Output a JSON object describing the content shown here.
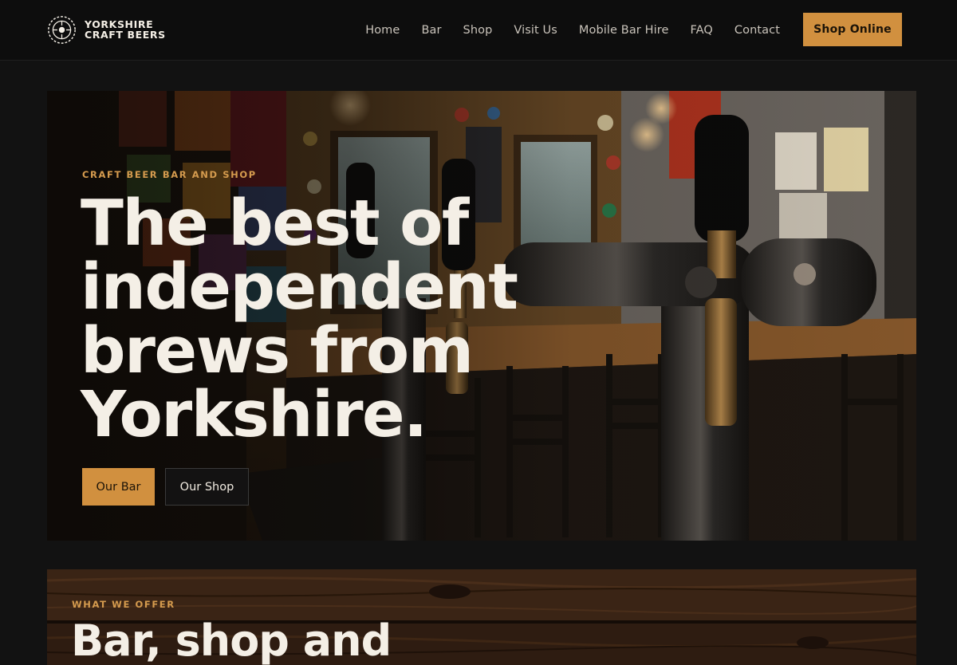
{
  "brand": {
    "line1": "YORKSHIRE",
    "line2": "CRAFT BEERS",
    "logo_icon": "roundel-logo-icon"
  },
  "nav": {
    "items": [
      {
        "label": "Home"
      },
      {
        "label": "Bar"
      },
      {
        "label": "Shop"
      },
      {
        "label": "Visit Us"
      },
      {
        "label": "Mobile Bar Hire"
      },
      {
        "label": "FAQ"
      },
      {
        "label": "Contact"
      }
    ],
    "cta_label": "Shop Online"
  },
  "hero": {
    "eyebrow": "CRAFT BEER BAR AND SHOP",
    "title_lines": [
      "The best of",
      "independent",
      "brews from",
      "Yorkshire."
    ],
    "primary_button": "Our Bar",
    "secondary_button": "Our Shop"
  },
  "offer": {
    "eyebrow": "WHAT WE OFFER",
    "title": "Bar, shop and"
  },
  "colors": {
    "accent": "#d1903f",
    "background": "#121212",
    "nav_background": "#0d0d0d",
    "text_light": "#f4efe6"
  }
}
